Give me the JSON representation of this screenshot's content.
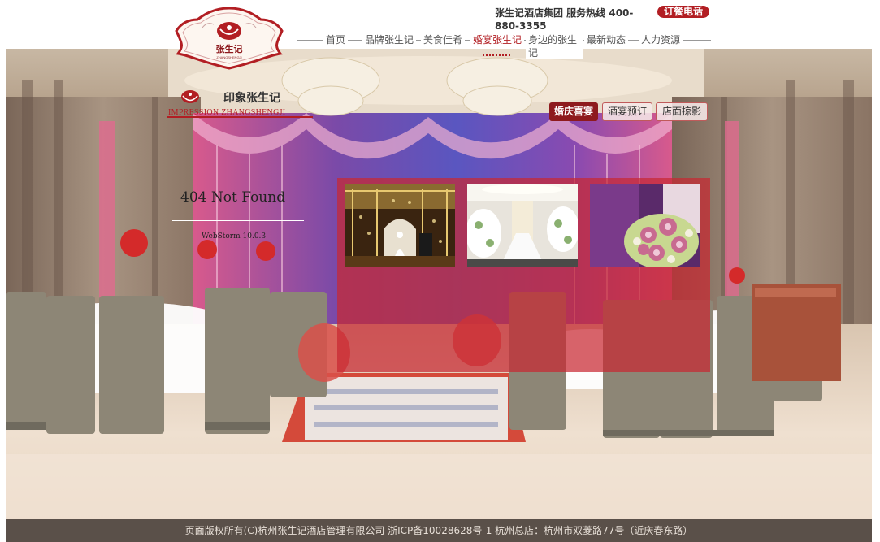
{
  "header": {
    "logo_text": "张生记",
    "logo_subtext": "ZHANGSHENGJI",
    "hotline": "张生记酒店集团 服务热线 400-880-3355",
    "order_button": "订餐电话"
  },
  "nav": [
    {
      "label": "首页",
      "active": false
    },
    {
      "label": "品牌张生记",
      "active": false
    },
    {
      "label": "美食佳肴",
      "active": false
    },
    {
      "label": "婚宴张生记",
      "active": true
    },
    {
      "label": "身边的张生记",
      "active": false
    },
    {
      "label": "最新动态",
      "active": false
    },
    {
      "label": "人力资源",
      "active": false
    }
  ],
  "impression": {
    "title_cn": "印象张生记",
    "title_en": "IMPRESSION   ZHANGSHENGJI"
  },
  "tabs": [
    {
      "label": "婚庆喜宴",
      "active": true
    },
    {
      "label": "酒宴预订",
      "active": false
    },
    {
      "label": "店面掠影",
      "active": false
    }
  ],
  "error": {
    "title": "404 Not Found",
    "server": "WebStorm 10.0.3"
  },
  "footer": {
    "text": "页面版权所有(C)杭州张生记酒店管理有限公司 浙ICP备10028628号-1 杭州总店：杭州市双菱路77号（近庆春东路）"
  },
  "colors": {
    "brand_red": "#b21e23",
    "panel_red": "#c82832",
    "tab_active": "#8e1a1e"
  }
}
